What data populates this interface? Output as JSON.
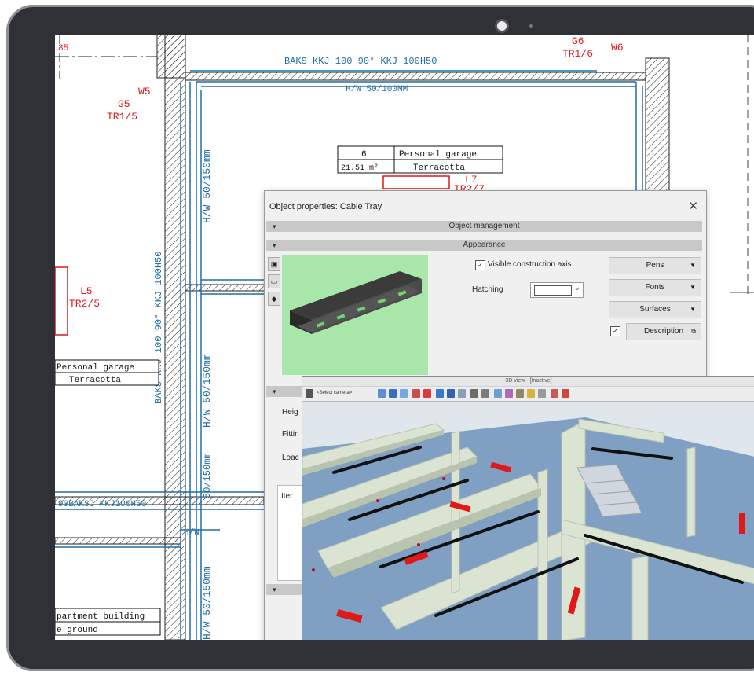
{
  "drawing": {
    "top_label": "BAKS  KKJ 100 90° KKJ 100H50",
    "top_dim": "H/W 50/100MM",
    "vertical_1": "BAKS  KKJ 100 90° KKJ 100H50",
    "vertical_2": "H/W 50/150mm",
    "vertical_3": "H/W 50/150mm",
    "vertical_4": "H/W 50/150mm",
    "vertical_5": "H/W 50/150mm",
    "vertical_6": "50/150mm",
    "bottom_horizontal": "90BAKSJ KKJ100H50",
    "hw_left": "H/W",
    "mm_left": "50/150mm",
    "room_number": "6",
    "room_name": "Personal garage",
    "room_area": "21.51 m²",
    "room_finish": "Terracotta",
    "left_room_name": "Personal garage",
    "left_room_finish": "Terracotta",
    "bottom_room_line1": "partment building",
    "bottom_room_line2": "e ground",
    "label_35": "35",
    "tags": {
      "w5": "W5",
      "g5": "G5",
      "tr15": "TR1/5",
      "g6": "G6",
      "tr16": "TR1/6",
      "w6": "W6",
      "l5": "L5",
      "tr25": "TR2/5",
      "l7": "L7",
      "tr27": "TR2/7"
    }
  },
  "dialog": {
    "title": "Object properties: Cable Tray",
    "section_object_management": "Object management",
    "section_appearance": "Appearance",
    "visible_axis_label": "Visible construction axis",
    "hatching_label": "Hatching",
    "pens_label": "Pens",
    "fonts_label": "Fonts",
    "surfaces_label": "Surfaces",
    "description_label": "Description",
    "height_label": "Heig",
    "fitting_label": "Fittin",
    "load_label": "Loac",
    "item_label": "Iter"
  },
  "view3d": {
    "title": "3D view - [Inactive]",
    "camera_select": "<Select camera>"
  },
  "colors": {
    "cad_blue": "#1f6fa5",
    "cad_red": "#e01818",
    "preview_bg": "#a9e6a9",
    "floor": "#7f9fc3",
    "walls": "#d9e4cf",
    "bezel": "#2f3136"
  }
}
